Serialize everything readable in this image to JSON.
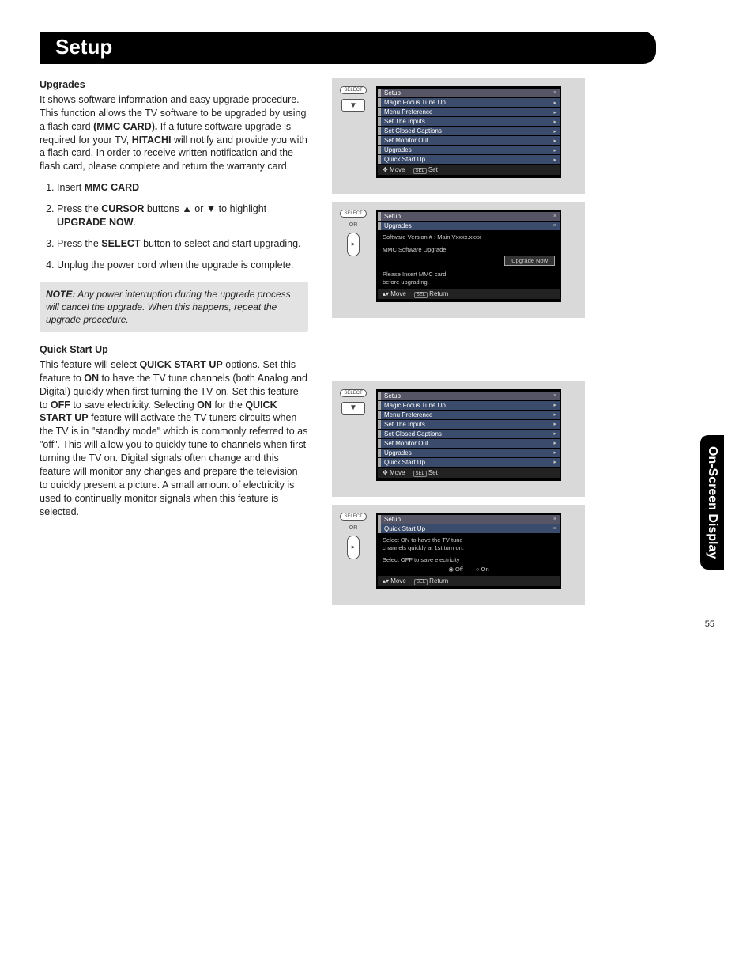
{
  "page": {
    "title": "Setup",
    "sideTab": "On-Screen Display",
    "number": "55"
  },
  "upgrades": {
    "heading": "Upgrades",
    "intro_a": "It shows software information and easy upgrade procedure. This function allows the TV software to be upgraded by using a flash card ",
    "mmc": "(MMC CARD).",
    "intro_b": " If a future software upgrade is required for your TV, ",
    "hitachi": "HITACHI",
    "intro_c": " will notify and provide you with a flash card. In order to receive written notification and the flash card, please complete and return the warranty card.",
    "step1_a": "Insert ",
    "step1_b": "MMC CARD",
    "step2_a": "Press the ",
    "step2_b": "CURSOR",
    "step2_c": " buttons ▲ or ▼ to highlight ",
    "step2_d": "UPGRADE NOW",
    "step2_e": ".",
    "step3_a": "Press the ",
    "step3_b": "SELECT",
    "step3_c": " button to select and start upgrading.",
    "step4": "Unplug the power cord when the upgrade is complete.",
    "noteLabel": "NOTE:",
    "noteText": " Any power interruption during the upgrade process will cancel the upgrade. When this happens, repeat the upgrade procedure."
  },
  "quick": {
    "heading": "Quick Start Up",
    "a": "This feature will select ",
    "b": "QUICK START UP",
    "c": " options. Set this feature to ",
    "on": "ON",
    "d": " to have the TV tune channels (both Analog and Digital) quickly when first turning the TV on. Set this feature to ",
    "off": "OFF",
    "e": " to save electricity. Selecting ",
    "f": " for the ",
    "g": " feature will activate the TV tuners circuits when the TV is in \"standby mode\" which is commonly referred to as \"off\". This will allow you to quickly tune to channels when first turning the TV on. Digital signals often change and this feature will monitor any changes and prepare the television to quickly present a picture. A small amount of electricity is used to continually monitor signals when this feature is selected."
  },
  "osd": {
    "selectBtn": "SELECT",
    "or": "OR",
    "move": "Move",
    "set": "Set",
    "ret": "Return",
    "sel": "SEL",
    "setup": "Setup",
    "items": [
      "Magic Focus Tune Up",
      "Menu Preference",
      "Set The Inputs",
      "Set Closed Captions",
      "Set Monitor Out",
      "Upgrades",
      "Quick Start Up"
    ],
    "upgradesTitle": "Upgrades",
    "swVersion": "Software Version #  :  Main Vxxxx.xxxx",
    "mmcUpg": "MMC Software Upgrade",
    "upgradeNow": "Upgrade Now",
    "insertMsg1": "Please Insert MMC card",
    "insertMsg2": "before upgrading.",
    "qsuTitle": "Quick Start Up",
    "qsuLine1": "Select ON to have the TV tune",
    "qsuLine2": "channels quickly at 1st turn on.",
    "qsuLine3": "Select OFF to save electricity",
    "qsuOff": "Off",
    "qsuOn": "On"
  }
}
